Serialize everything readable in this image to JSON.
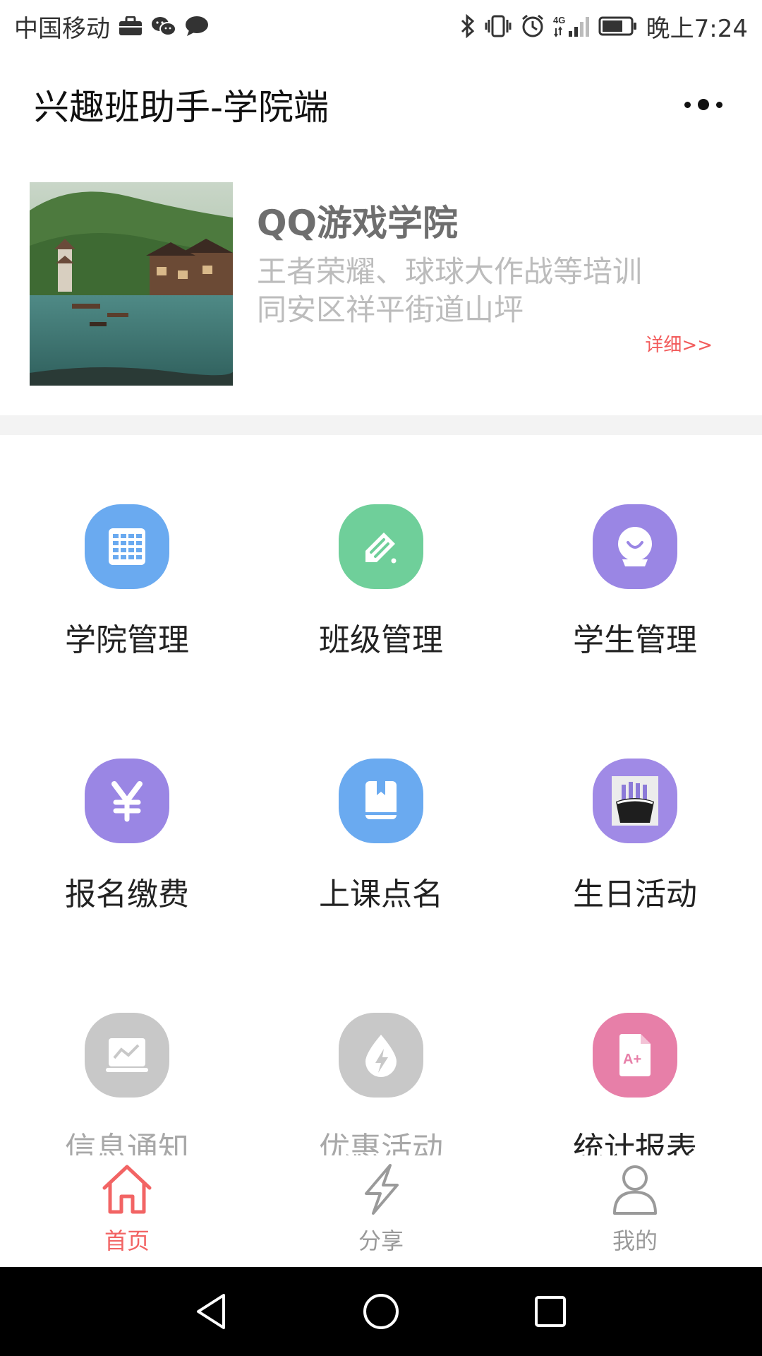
{
  "status_bar": {
    "carrier": "中国移动",
    "time": "晚上7:24",
    "left_icons": [
      "briefcase-icon",
      "wechat-icon",
      "message-icon"
    ],
    "right_icons": [
      "bluetooth-icon",
      "vibrate-icon",
      "alarm-icon",
      "signal-4g-icon",
      "battery-icon"
    ]
  },
  "header": {
    "title": "兴趣班助手-学院端",
    "menu_icon": "more-dots-icon"
  },
  "academy": {
    "name": "QQ游戏学院",
    "description_line1": "王者荣耀、球球大作战等培训",
    "description_line2": "同安区祥平街道山坪",
    "detail_link": "详细>>"
  },
  "menu": {
    "items": [
      {
        "label": "学院管理",
        "icon": "calendar-grid-icon",
        "color": "#6aaaf0",
        "enabled": true
      },
      {
        "label": "班级管理",
        "icon": "edit-tag-icon",
        "color": "#6fcf9a",
        "enabled": true
      },
      {
        "label": "学生管理",
        "icon": "camera-webcam-icon",
        "color": "#9a86e4",
        "enabled": true
      },
      {
        "label": "报名缴费",
        "icon": "yen-icon",
        "color": "#9a86e4",
        "enabled": true
      },
      {
        "label": "上课点名",
        "icon": "book-icon",
        "color": "#6aaaf0",
        "enabled": true
      },
      {
        "label": "生日活动",
        "icon": "birthday-cake-icon",
        "color": "#a08ae6",
        "enabled": true
      },
      {
        "label": "信息通知",
        "icon": "chart-monitor-icon",
        "color": "#c8c8c8",
        "enabled": false
      },
      {
        "label": "优惠活动",
        "icon": "lightning-drop-icon",
        "color": "#c8c8c8",
        "enabled": false
      },
      {
        "label": "统计报表",
        "icon": "grade-report-icon",
        "color": "#e77fa8",
        "enabled": true
      }
    ]
  },
  "tabbar": {
    "tabs": [
      {
        "label": "首页",
        "icon": "home-icon",
        "active": true
      },
      {
        "label": "分享",
        "icon": "lightning-icon",
        "active": false
      },
      {
        "label": "我的",
        "icon": "person-icon",
        "active": false
      }
    ],
    "active_color": "#f26464",
    "inactive_color": "#9a9a9a"
  },
  "system_nav": {
    "buttons": [
      "back-icon",
      "home-circle-icon",
      "recents-icon"
    ]
  }
}
